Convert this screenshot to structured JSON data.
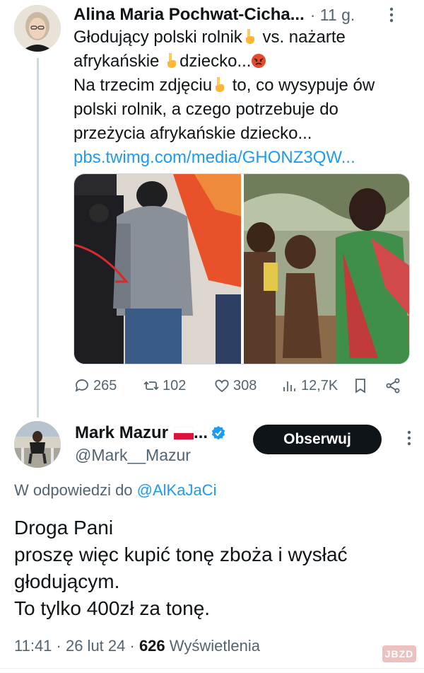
{
  "tweet1": {
    "author_name": "Alina Maria Pochwat-Cicha...",
    "time": "· 11 g.",
    "lines": [
      {
        "before": "Głodujący polski rolnik",
        "emoji": "backhand-index-pointing-down",
        "after": " vs. nażarte"
      },
      {
        "before": "afrykańskie ",
        "emoji": "backhand-index-pointing-down",
        "after": "dziecko...",
        "emoji2": "angry-face"
      },
      {
        "before": "Na trzecim zdjęciu",
        "emoji": "backhand-index-pointing-down",
        "after": " to, co wysypuje ów"
      },
      {
        "before": "polski rolnik, a czego potrzebuje do"
      },
      {
        "before": "przeżycia afrykańskie dziecko..."
      }
    ],
    "link": "pbs.twimg.com/media/GHONZ3QW...",
    "stats": {
      "replies": "265",
      "reposts": "102",
      "likes": "308",
      "views": "12,7K"
    }
  },
  "tweet2": {
    "author_name": "Mark Mazur",
    "flag": "poland-flag-emoji",
    "name_suffix": "...",
    "verified": "verified-badge",
    "handle": "@Mark__Mazur",
    "follow_label": "Obserwuj",
    "reply_prefix": "W odpowiedzi do ",
    "reply_handle": "@AlKaJaCi",
    "lines": [
      "Droga Pani",
      "proszę więc kupić tonę zboża i wysłać",
      "głodującym.",
      "To tylko 400zł za tonę."
    ],
    "time": "11:41 · 26 lut 24 · ",
    "views_count": "626",
    "views_label": " Wyświetlenia"
  },
  "watermark": "JBZD",
  "colors": {
    "link": "#1d9bf0",
    "muted": "#536471",
    "text": "#0f1419",
    "verified": "#1d9bf0",
    "follow_bg": "#0f1419"
  }
}
